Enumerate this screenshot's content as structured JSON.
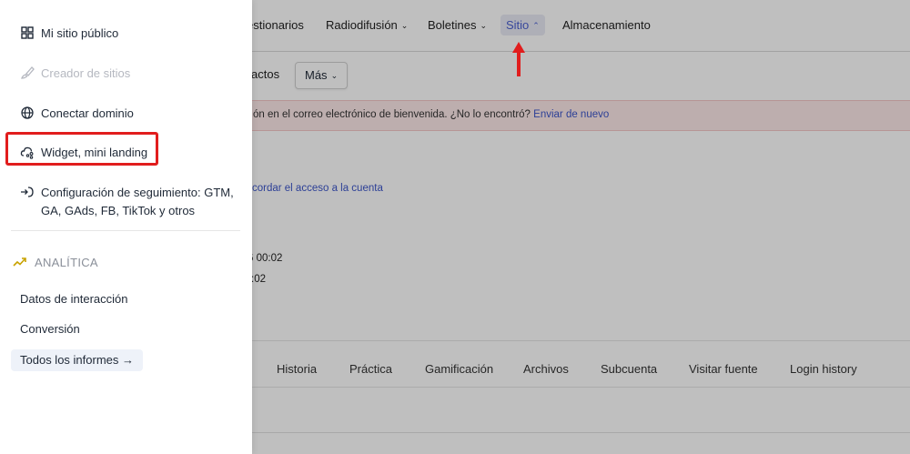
{
  "top_nav": {
    "items": [
      {
        "label": "estionarios"
      },
      {
        "label": "Radiodifusión"
      },
      {
        "label": "Boletines"
      },
      {
        "label": "Sitio"
      },
      {
        "label": "Almacenamiento"
      }
    ]
  },
  "sub_nav": {
    "contacts_label": "actos",
    "more_label": "Más"
  },
  "alert": {
    "text": "ón en el correo electrónico de bienvenida. ¿No lo encontró?",
    "link": "Enviar de nuevo"
  },
  "account": {
    "access_link": "cordar el acceso a la cuenta",
    "time_1": "6 00:02",
    "time_2": ":02"
  },
  "tabs": [
    "Historia",
    "Práctica",
    "Gamificación",
    "Archivos",
    "Subcuenta",
    "Visitar fuente",
    "Login history"
  ],
  "menu": {
    "items": [
      {
        "label": "Mi sitio público",
        "icon": "grid-icon"
      },
      {
        "label": "Creador de sitios",
        "icon": "brush-icon",
        "disabled": true
      },
      {
        "label": "Conectar dominio",
        "icon": "globe-icon"
      },
      {
        "label": "Widget, mini landing",
        "icon": "cloud-share-icon"
      },
      {
        "label": "Configuración de seguimiento: GTM, GA, GAds, FB, TikTok y otros",
        "icon": "tracking-icon"
      }
    ],
    "analytics_title": "ANALÍTICA",
    "analytics_items": [
      "Datos de interacción",
      "Conversión"
    ],
    "all_reports": "Todos los informes →"
  },
  "colors": {
    "accent": "#4b5fd0",
    "highlight_border": "#e11d1d",
    "alert_bg": "#fde8e8",
    "analytics_icon": "#c8a200"
  }
}
